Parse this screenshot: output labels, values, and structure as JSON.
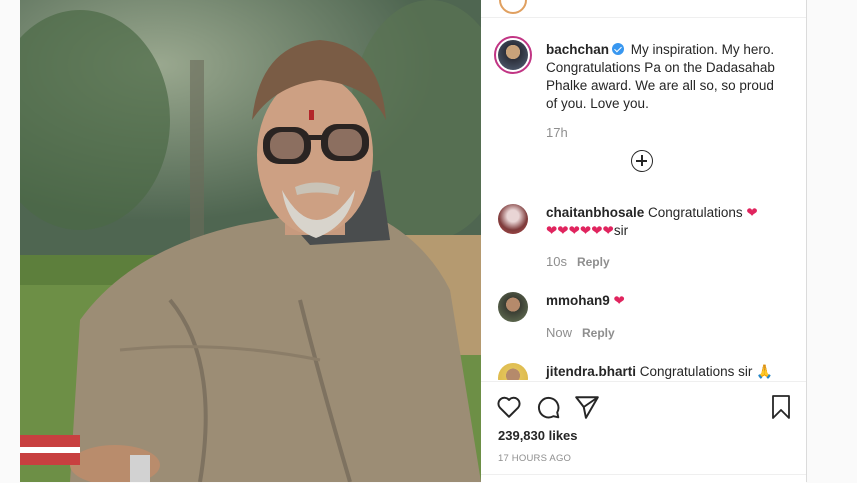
{
  "post": {
    "username": "bachchan",
    "caption": "My inspiration. My hero. Congratulations Pa on the Dadasahab Phalke award. We are all so, so proud of you. Love you.",
    "caption_time": "17h"
  },
  "comments": [
    {
      "username": "chaitanbhosale",
      "text": "Congratulations",
      "hearts_line": "❤❤❤❤❤❤",
      "suffix": "sir",
      "time": "10s",
      "reply": "Reply"
    },
    {
      "username": "mmohan9",
      "text": "",
      "time": "Now",
      "reply": "Reply"
    },
    {
      "username": "jitendra.bharti",
      "text": "Congratulations sir 🙏"
    }
  ],
  "likes": "239,830 likes",
  "posted_ago": "17 HOURS AGO",
  "colors": {
    "accent": "#3897f0",
    "heart": "#e0245e"
  }
}
